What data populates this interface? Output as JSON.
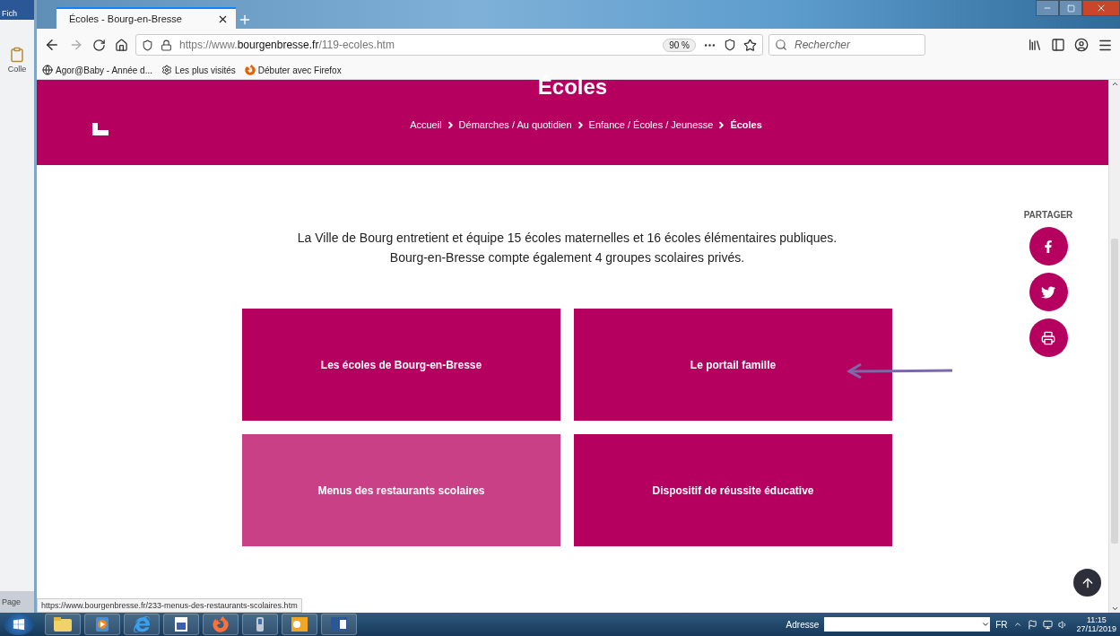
{
  "word_window": {
    "menu_tab": "Fich",
    "clipboard_label": "Colle",
    "status_label": "Page"
  },
  "browser": {
    "tabs": [
      {
        "title": "Écoles - Bourg-en-Bresse",
        "selected": true
      }
    ],
    "url": "https://www.**bourgenbresse.fr**/119-ecoles.htm",
    "zoom": "90 %",
    "search_placeholder": "Rechercher",
    "bookmarks": [
      {
        "label": "Agor@Baby - Année d...",
        "kind": "globe"
      },
      {
        "label": "Les plus visités",
        "kind": "gear"
      },
      {
        "label": "Débuter avec Firefox",
        "kind": "firefox"
      }
    ],
    "status_url": "https://www.bourgenbresse.fr/233-menus-des-restaurants-scolaires.htm"
  },
  "page": {
    "title": "Écoles",
    "breadcrumb": [
      {
        "label": "Accueil",
        "current": false
      },
      {
        "label": "Démarches / Au quotidien",
        "current": false
      },
      {
        "label": "Enfance / Écoles / Jeunesse",
        "current": false
      },
      {
        "label": "Écoles",
        "current": true
      }
    ],
    "intro": [
      "La Ville de Bourg entretient et équipe 15 écoles maternelles et 16 écoles élémentaires publiques.",
      "Bourg-en-Bresse compte également 4 groupes scolaires privés."
    ],
    "tiles": [
      {
        "label": "Les écoles de Bourg-en-Bresse",
        "highlighted": false
      },
      {
        "label": "Le portail famille",
        "highlighted": false
      },
      {
        "label": "Menus des restaurants scolaires",
        "highlighted": true
      },
      {
        "label": "Dispositif de réussite éducative",
        "highlighted": false
      }
    ],
    "share": {
      "label": "PARTAGER",
      "buttons": [
        {
          "kind": "facebook"
        },
        {
          "kind": "twitter"
        },
        {
          "kind": "print"
        }
      ]
    }
  },
  "taskbar": {
    "apps": [
      {
        "kind": "folder"
      },
      {
        "kind": "media"
      },
      {
        "kind": "ie"
      },
      {
        "kind": "calendar"
      },
      {
        "kind": "firefox"
      },
      {
        "kind": "phone"
      },
      {
        "kind": "outlook"
      },
      {
        "kind": "word"
      }
    ],
    "address_label": "Adresse",
    "language": "FR",
    "time": "11:15",
    "date": "27/11/2019"
  }
}
